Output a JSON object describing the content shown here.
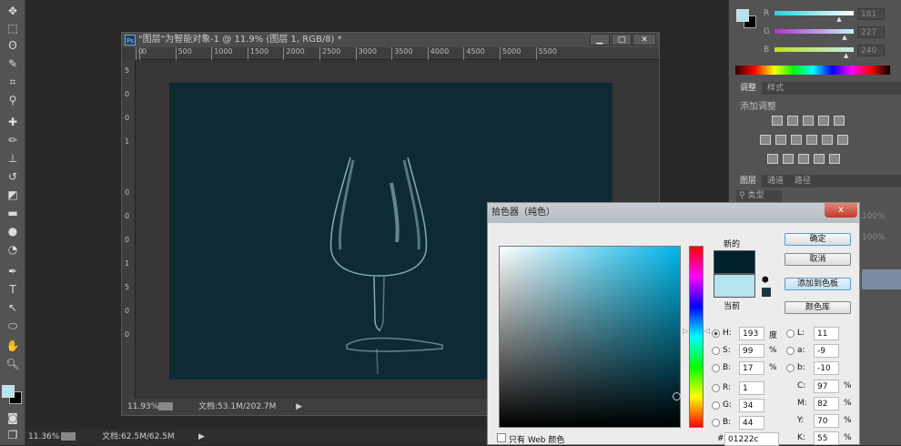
{
  "document": {
    "title": "\"图层\"为智能对象-1 @ 11.9% (图层 1, RGB/8) *",
    "ruler_h": [
      "0",
      "0",
      "500",
      "1000",
      "1500",
      "2000",
      "2500",
      "3000",
      "3500",
      "4000",
      "4500",
      "5000",
      "5500"
    ],
    "ruler_v": [
      "5",
      "0",
      "0",
      "1",
      "0",
      "0",
      "0",
      "1",
      "5",
      "0",
      "0"
    ],
    "zoom": "11.93%",
    "doc_size": "文档:53.1M/202.7M",
    "image_color": "#0e2a33"
  },
  "app_status": {
    "zoom": "11.36%",
    "doc_size": "文档:62.5M/62.5M"
  },
  "color_panel": {
    "fg": "#b5e3f0",
    "bg": "#000000",
    "channels": [
      {
        "label": "R",
        "value": "181"
      },
      {
        "label": "G",
        "value": "227"
      },
      {
        "label": "B",
        "value": "240"
      }
    ]
  },
  "adjustments": {
    "tabs": [
      "调整",
      "样式"
    ],
    "heading": "添加调整"
  },
  "layers": {
    "tabs": [
      "图层",
      "通道",
      "路径"
    ],
    "filter": "类型",
    "opacity": "100%",
    "fill": "100%"
  },
  "picker": {
    "title": "拾色器（纯色）",
    "close": "x",
    "new_label": "新的",
    "current_label": "当前",
    "new_color": "#01222c",
    "current_color": "#b5e3f0",
    "buttons": [
      "确定",
      "取消",
      "添加到色板",
      "颜色库"
    ],
    "hsb": [
      {
        "label": "H:",
        "value": "193",
        "unit": "度",
        "selected": true
      },
      {
        "label": "S:",
        "value": "99",
        "unit": "%"
      },
      {
        "label": "B:",
        "value": "17",
        "unit": "%"
      }
    ],
    "rgb": [
      {
        "label": "R:",
        "value": "1"
      },
      {
        "label": "G:",
        "value": "34"
      },
      {
        "label": "B:",
        "value": "44"
      }
    ],
    "lab": [
      {
        "label": "L:",
        "value": "11"
      },
      {
        "label": "a:",
        "value": "-9"
      },
      {
        "label": "b:",
        "value": "-10"
      }
    ],
    "cmyk": [
      {
        "label": "C:",
        "value": "97"
      },
      {
        "label": "M:",
        "value": "82"
      },
      {
        "label": "Y:",
        "value": "70"
      },
      {
        "label": "K:",
        "value": "55"
      }
    ],
    "cmyk_unit": "%",
    "web_only": "只有 Web 颜色",
    "hash": "#",
    "hex": "01222c"
  }
}
